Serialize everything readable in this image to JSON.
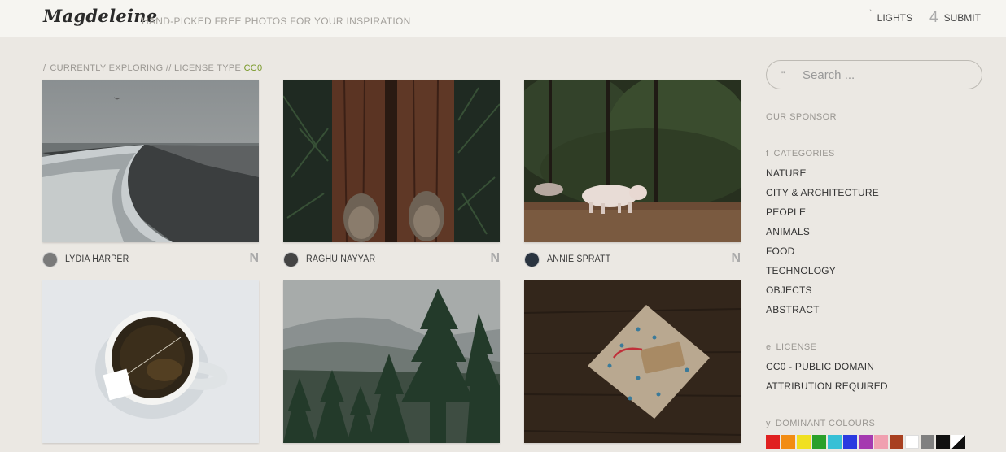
{
  "header": {
    "logo": "Magdeleine",
    "tagline": "HAND-PICKED FREE PHOTOS FOR YOUR INSPIRATION",
    "lights_icon": "`",
    "lights_label": "LIGHTS",
    "submit_icon": "4",
    "submit_label": "SUBMIT"
  },
  "breadcrumb": {
    "slash": "/",
    "text": "CURRENTLY EXPLORING // LICENSE TYPE ",
    "license": "CC0"
  },
  "photos": [
    {
      "author": "LYDIA HARPER",
      "license_icon": "N"
    },
    {
      "author": "RAGHU NAYYAR",
      "license_icon": "N"
    },
    {
      "author": "ANNIE SPRATT",
      "license_icon": "N"
    }
  ],
  "search": {
    "icon": "\"",
    "placeholder": "Search ..."
  },
  "sidebar": {
    "sponsor_heading": "OUR SPONSOR",
    "categories_icon": "f",
    "categories_heading": "CATEGORIES",
    "categories": [
      "NATURE",
      "CITY & ARCHITECTURE",
      "PEOPLE",
      "ANIMALS",
      "FOOD",
      "TECHNOLOGY",
      "OBJECTS",
      "ABSTRACT"
    ],
    "license_icon": "e",
    "license_heading": "LICENSE",
    "licenses": [
      "CC0 - PUBLIC DOMAIN",
      "ATTRIBUTION REQUIRED"
    ],
    "colours_icon": "y",
    "colours_heading": "DOMINANT COLOURS",
    "colours": [
      "#e02020",
      "#f28c13",
      "#f0e020",
      "#2aa02a",
      "#36c0d6",
      "#2a3ae0",
      "#a53ab0",
      "#f0a0b0",
      "#a84020",
      "#ffffff",
      "#808080",
      "#111111",
      "split"
    ]
  }
}
